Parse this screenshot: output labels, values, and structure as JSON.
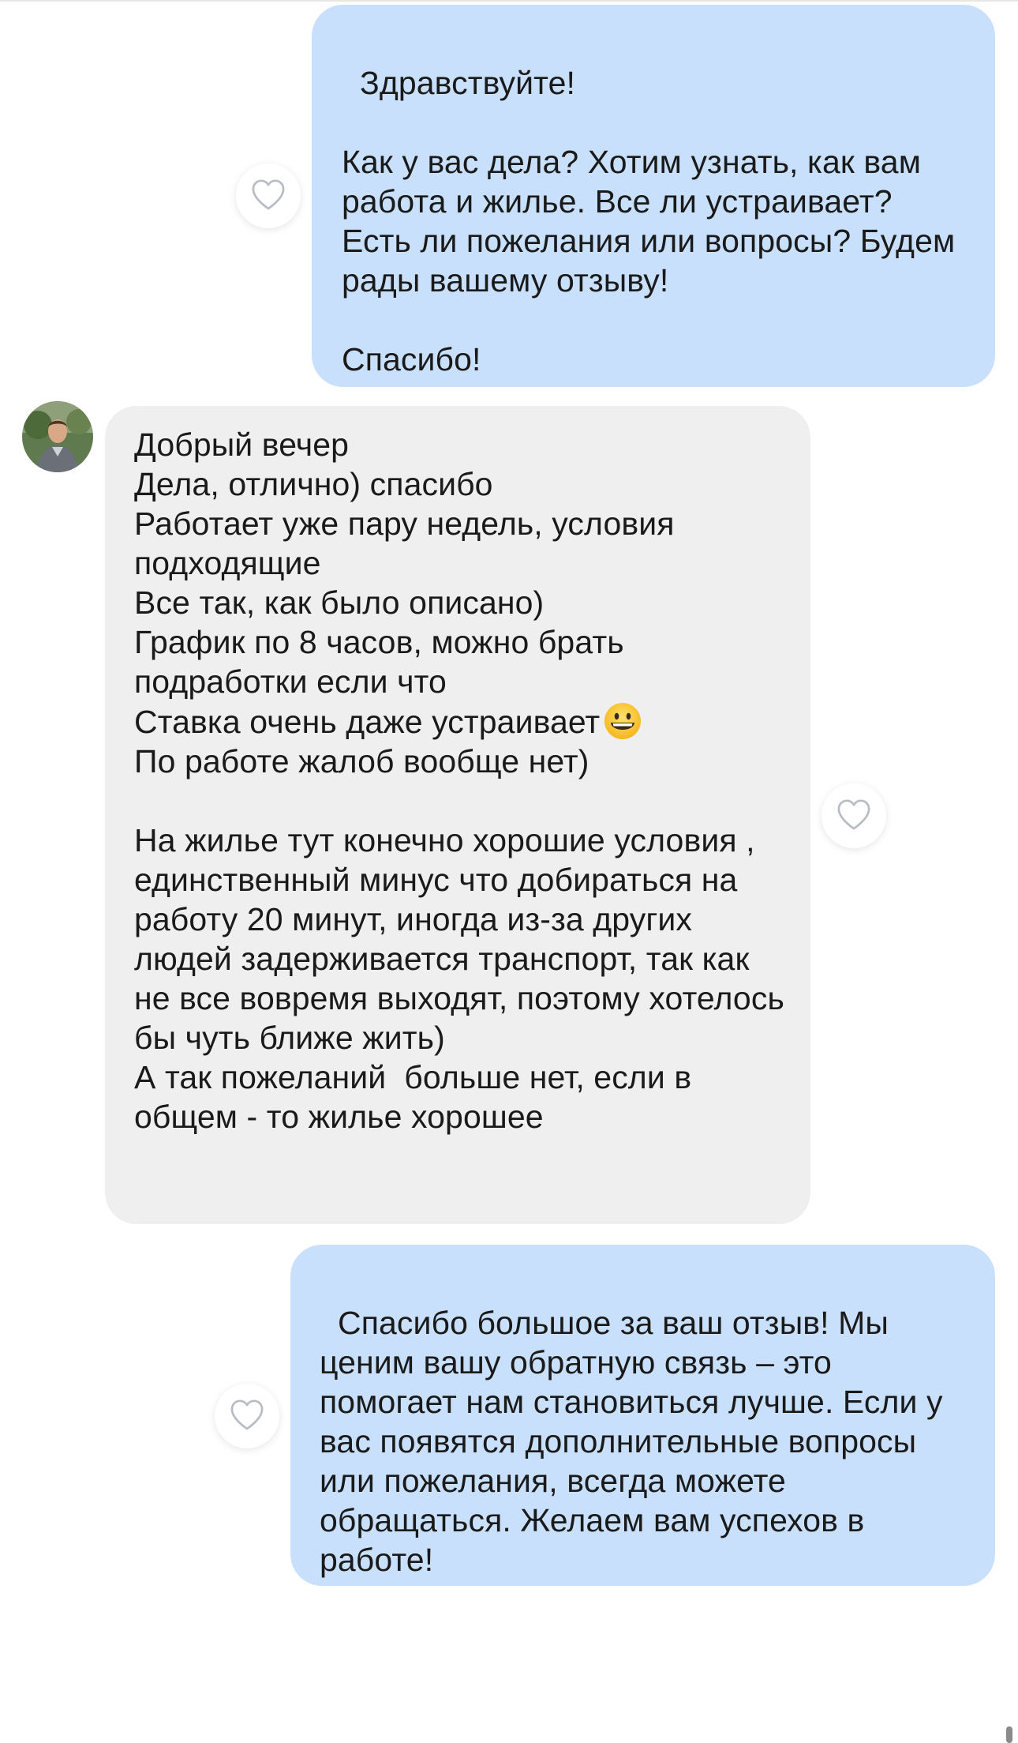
{
  "messages": [
    {
      "direction": "outgoing",
      "text": "Здравствуйте!\n\nКак у вас дела? Хотим узнать, как вам работа и жилье. Все ли устраивает? Есть ли пожелания или вопросы? Будем рады вашему отзыву!\n\nСпасибо!"
    },
    {
      "direction": "incoming",
      "text_before_emoji": "Добрый вечер\nДела, отлично) спасибо\nРаботает уже пару недель, условия подходящие\nВсе так, как было описано)\nГрафик по 8 часов, можно брать подработки если что\nСтавка очень даже устраивает",
      "emoji": "grinning-face",
      "text_after_emoji": "\nПо работе жалоб вообще нет)\n\nНа жилье тут конечно хорошие условия , единственный минус что добираться на работу 20 минут, иногда из-за других людей задерживается транспорт, так как не все вовремя выходят, поэтому хотелось бы чуть ближе жить)\nА так пожеланий  больше нет, если в общем - то жилье хорошее"
    },
    {
      "direction": "outgoing",
      "text": "Спасибо большое за ваш отзыв! Мы ценим вашу обратную связь – это помогает нам становиться лучше. Если у вас появятся дополнительные вопросы или пожелания, всегда можете обращаться. Желаем вам успехов в работе!"
    }
  ],
  "icons": {
    "like": "heart-outline-icon",
    "avatar": "user-avatar"
  },
  "colors": {
    "outgoing_bubble": "#c8e0fb",
    "incoming_bubble": "#efefef",
    "heart_stroke": "#b8bcc2",
    "text": "#1a1a1a"
  }
}
